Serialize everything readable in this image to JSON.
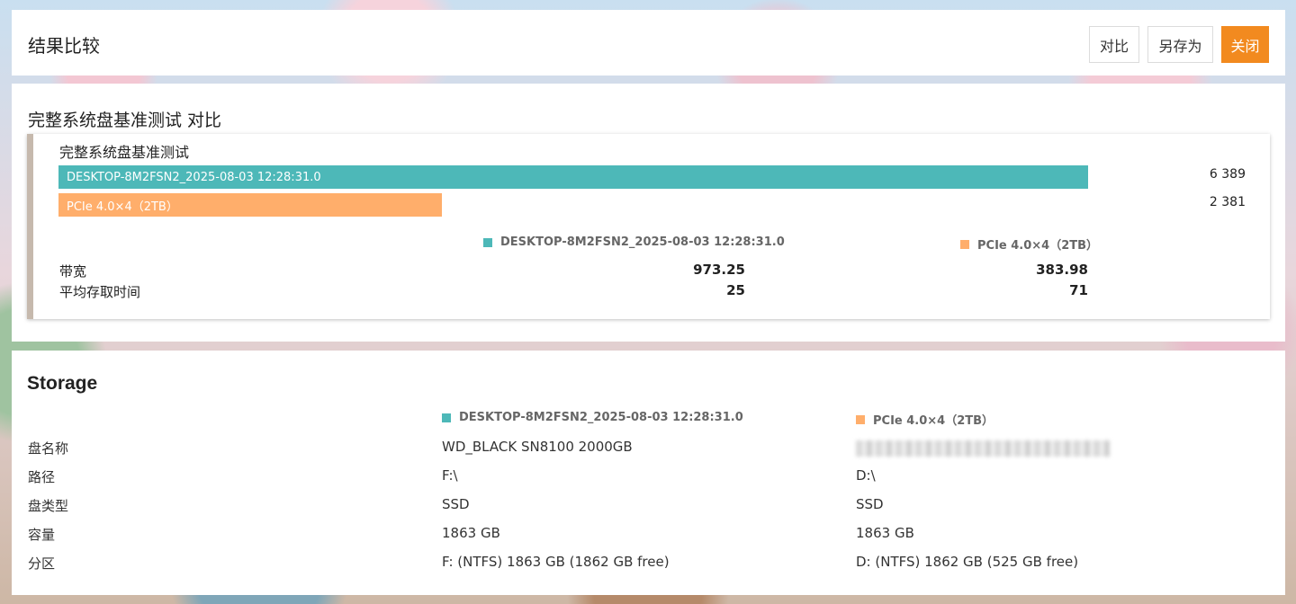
{
  "header": {
    "title": "结果比较",
    "buttons": {
      "compare": "对比",
      "save_as": "另存为",
      "close": "关闭"
    }
  },
  "colors": {
    "series1": "#4db8b8",
    "series2": "#ffae6b",
    "accent": "#f28a1f"
  },
  "comparison": {
    "section_title": "完整系统盘基准测试 对比",
    "card_title": "完整系统盘基准测试",
    "chart_data": {
      "type": "bar",
      "orientation": "horizontal",
      "series": [
        {
          "name": "DESKTOP-8M2FSN2_2025-08-03 12:28:31.0",
          "value": 6389,
          "value_label": "6 389"
        },
        {
          "name": "PCIe 4.0×4（2TB）",
          "value": 2381,
          "value_label": "2 381"
        }
      ],
      "max": 6389
    },
    "legend": [
      "DESKTOP-8M2FSN2_2025-08-03 12:28:31.0",
      "PCIe 4.0×4（2TB）"
    ],
    "metrics": [
      {
        "label": "带宽",
        "v1": "973.25",
        "v2": "383.98"
      },
      {
        "label": "平均存取时间",
        "v1": "25",
        "v2": "71"
      }
    ]
  },
  "storage": {
    "title": "Storage",
    "legend": [
      "DESKTOP-8M2FSN2_2025-08-03 12:28:31.0",
      "PCIe 4.0×4（2TB）"
    ],
    "rows": [
      {
        "label": "盘名称",
        "v1": "WD_BLACK SN8100 2000GB",
        "v2": "",
        "v2_blurred": true
      },
      {
        "label": "路径",
        "v1": "F:\\",
        "v2": "D:\\"
      },
      {
        "label": "盘类型",
        "v1": "SSD",
        "v2": "SSD"
      },
      {
        "label": "容量",
        "v1": "1863 GB",
        "v2": "1863 GB"
      },
      {
        "label": "分区",
        "v1": "F: (NTFS) 1863 GB (1862 GB free)",
        "v2": "D: (NTFS) 1862 GB (525 GB free)"
      }
    ]
  }
}
